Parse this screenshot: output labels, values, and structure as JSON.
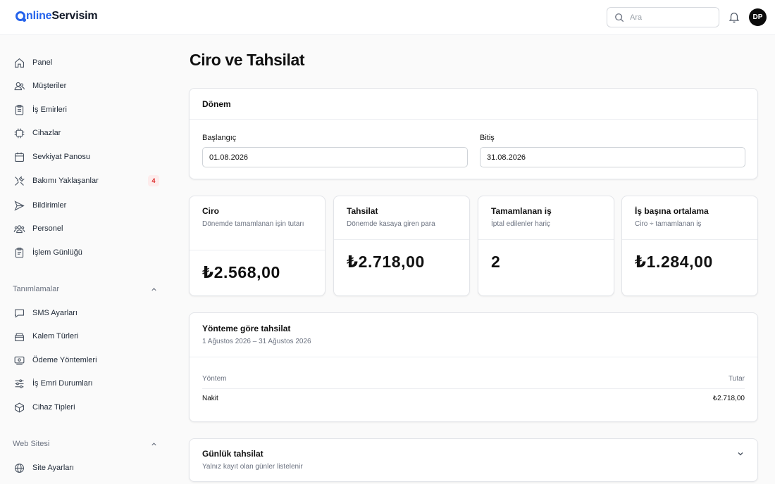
{
  "brand": {
    "first": "nline",
    "second": "Servisim"
  },
  "search": {
    "placeholder": "Ara"
  },
  "user": {
    "initials": "DP"
  },
  "sidebar": {
    "items": [
      {
        "label": "Panel",
        "icon": "home-icon"
      },
      {
        "label": "Müşteriler",
        "icon": "users-icon"
      },
      {
        "label": "İş Emirleri",
        "icon": "clipboard-icon"
      },
      {
        "label": "Cihazlar",
        "icon": "chip-icon"
      },
      {
        "label": "Sevkiyat Panosu",
        "icon": "calendar-icon"
      },
      {
        "label": "Bakımı Yaklaşanlar",
        "icon": "tools-icon",
        "badge": "4"
      },
      {
        "label": "Bildirimler",
        "icon": "send-icon"
      },
      {
        "label": "Personel",
        "icon": "team-icon"
      },
      {
        "label": "İşlem Günlüğü",
        "icon": "log-icon"
      }
    ],
    "sections": [
      {
        "title": "Tanımlamalar",
        "items": [
          {
            "label": "SMS Ayarları",
            "icon": "message-icon"
          },
          {
            "label": "Kalem Türleri",
            "icon": "box-icon"
          },
          {
            "label": "Ödeme Yöntemleri",
            "icon": "payment-icon"
          },
          {
            "label": "İş Emri Durumları",
            "icon": "sliders-icon"
          },
          {
            "label": "Cihaz Tipleri",
            "icon": "cube-icon"
          }
        ]
      },
      {
        "title": "Web Sitesi",
        "items": [
          {
            "label": "Site Ayarları",
            "icon": "globe-icon"
          }
        ]
      }
    ]
  },
  "page": {
    "title": "Ciro ve Tahsilat"
  },
  "period": {
    "title": "Dönem",
    "start_label": "Başlangıç",
    "start_value": "01.08.2026",
    "end_label": "Bitiş",
    "end_value": "31.08.2026"
  },
  "stats": [
    {
      "title": "Ciro",
      "subtitle": "Dönemde tamamlanan işin tutarı",
      "value": "₺2.568,00"
    },
    {
      "title": "Tahsilat",
      "subtitle": "Dönemde kasaya giren para",
      "value": "₺2.718,00"
    },
    {
      "title": "Tamamlanan iş",
      "subtitle": "İptal edilenler hariç",
      "value": "2"
    },
    {
      "title": "İş başına ortalama",
      "subtitle": "Ciro ÷ tamamlanan iş",
      "value": "₺1.284,00"
    }
  ],
  "by_method": {
    "title": "Yönteme göre tahsilat",
    "subtitle": "1 Ağustos 2026 – 31 Ağustos 2026",
    "columns": [
      "Yöntem",
      "Tutar"
    ],
    "rows": [
      {
        "method": "Nakit",
        "amount": "₺2.718,00"
      }
    ]
  },
  "daily": {
    "title": "Günlük tahsilat",
    "subtitle": "Yalnız kayıt olan günler listelenir"
  }
}
